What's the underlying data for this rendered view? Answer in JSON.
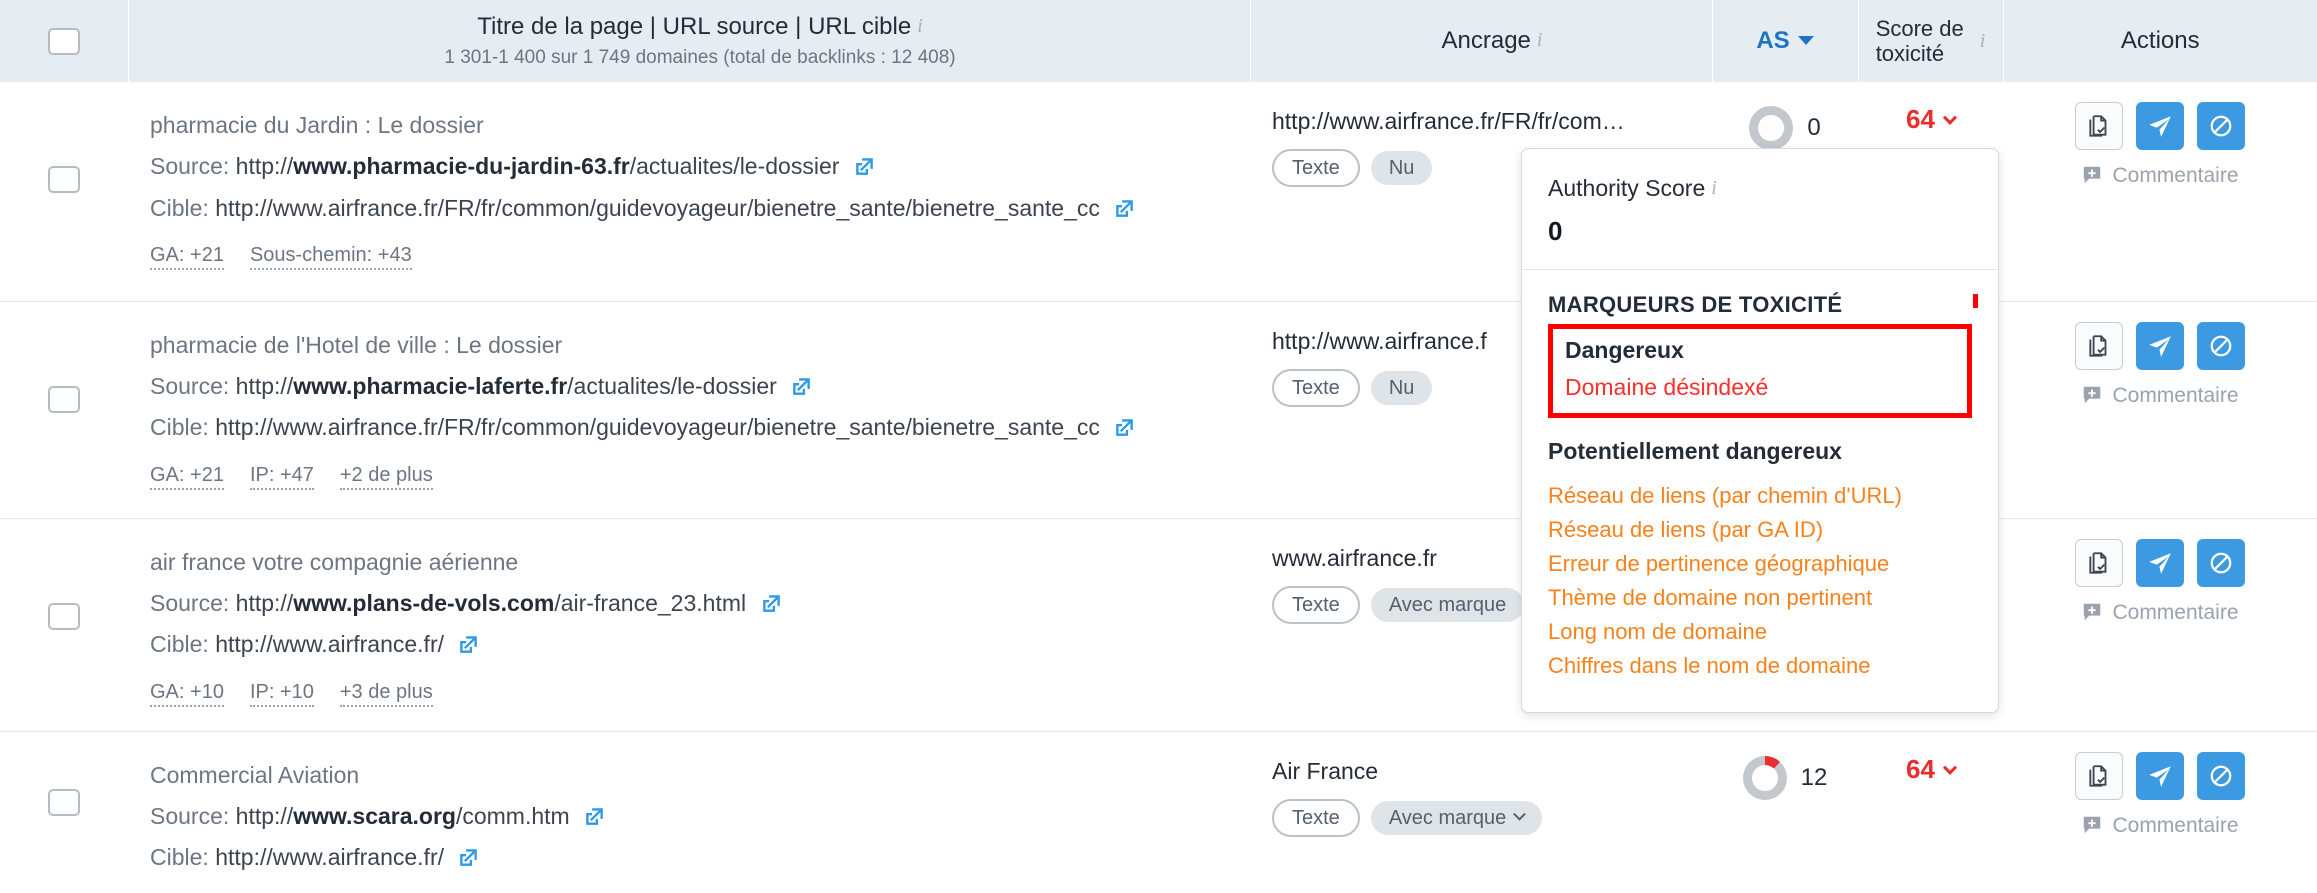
{
  "header": {
    "title_main": "Titre de la page | URL source | URL cible",
    "title_sub": "1 301-1 400 sur 1 749 domaines (total de backlinks : 12 408)",
    "anchor": "Ancrage",
    "as": "AS",
    "toxicity_line1": "Score de",
    "toxicity_line2": "toxicité",
    "actions": "Actions"
  },
  "labels": {
    "source": "Source:",
    "cible": "Cible:",
    "comment": "Commentaire"
  },
  "colors": {
    "header_bg": "#e5ecf2",
    "accent_blue": "#3b9ae1",
    "link_blue": "#1e74c0",
    "toxic_red": "#eb2d2d",
    "marker_orange": "#f7821b",
    "marker_red": "#fc2e2e",
    "highlight_box": "#ff0000"
  },
  "rows": [
    {
      "title": "pharmacie du Jardin : Le dossier",
      "source_prefix": "http://",
      "source_domain": "www.pharmacie-du-jardin-63.fr",
      "source_path": "/actualites/le-dossier",
      "target_full": "http://www.airfrance.fr/FR/fr/common/guidevoyageur/bienetre_sante/bienetre_sante_cc",
      "badges": [
        "GA: +21",
        "Sous-chemin: +43"
      ],
      "anchor_url": "http://www.airfrance.fr/FR/fr/com…",
      "tags": [
        "Texte",
        "Nu"
      ],
      "tag_has_caret": false,
      "as_value": "0",
      "as_percent": 0,
      "toxicity": "64"
    },
    {
      "title": "pharmacie de l'Hotel de ville : Le dossier",
      "source_prefix": "http://",
      "source_domain": "www.pharmacie-laferte.fr",
      "source_path": "/actualites/le-dossier",
      "target_full": "http://www.airfrance.fr/FR/fr/common/guidevoyageur/bienetre_sante/bienetre_sante_cc",
      "badges": [
        "GA: +21",
        "IP: +47",
        "+2 de plus"
      ],
      "anchor_url": "http://www.airfrance.f",
      "tags": [
        "Texte",
        "Nu"
      ],
      "tag_has_caret": false,
      "as_value": "",
      "as_percent": 0,
      "toxicity": ""
    },
    {
      "title": "air france votre compagnie aérienne",
      "source_prefix": "http://",
      "source_domain": "www.plans-de-vols.com",
      "source_path": "/air-france_23.html",
      "target_full": "http://www.airfrance.fr/",
      "badges": [
        "GA: +10",
        "IP: +10",
        "+3 de plus"
      ],
      "anchor_url": "www.airfrance.fr",
      "tags": [
        "Texte",
        "Avec marque"
      ],
      "tag_has_caret": false,
      "as_value": "",
      "as_percent": 0,
      "toxicity": ""
    },
    {
      "title": "Commercial Aviation",
      "source_prefix": "http://",
      "source_domain": "www.scara.org",
      "source_path": "/comm.htm",
      "target_full": "http://www.airfrance.fr/",
      "badges": [],
      "anchor_url": "Air France",
      "tags": [
        "Texte",
        "Avec marque"
      ],
      "tag_has_caret": true,
      "as_value": "12",
      "as_percent": 12,
      "toxicity": "64"
    }
  ],
  "popup": {
    "as_label": "Authority Score",
    "as_value": "0",
    "markers_heading": "MARQUEURS DE TOXICITÉ",
    "dangerous_heading": "Dangereux",
    "dangerous_items": [
      "Domaine désindexé"
    ],
    "potential_heading": "Potentiellement dangereux",
    "potential_items": [
      "Réseau de liens (par chemin d'URL)",
      "Réseau de liens (par GA ID)",
      "Erreur de pertinence géographique",
      "Thème de domaine non pertinent",
      "Long nom de domaine",
      "Chiffres dans le nom de domaine"
    ]
  },
  "icons": {
    "external_link": "external-link-icon",
    "info": "info-icon",
    "chevron_down": "chevron-down-icon",
    "document_check": "document-check-icon",
    "send": "send-icon",
    "block": "block-icon",
    "comment_add": "comment-add-icon"
  }
}
